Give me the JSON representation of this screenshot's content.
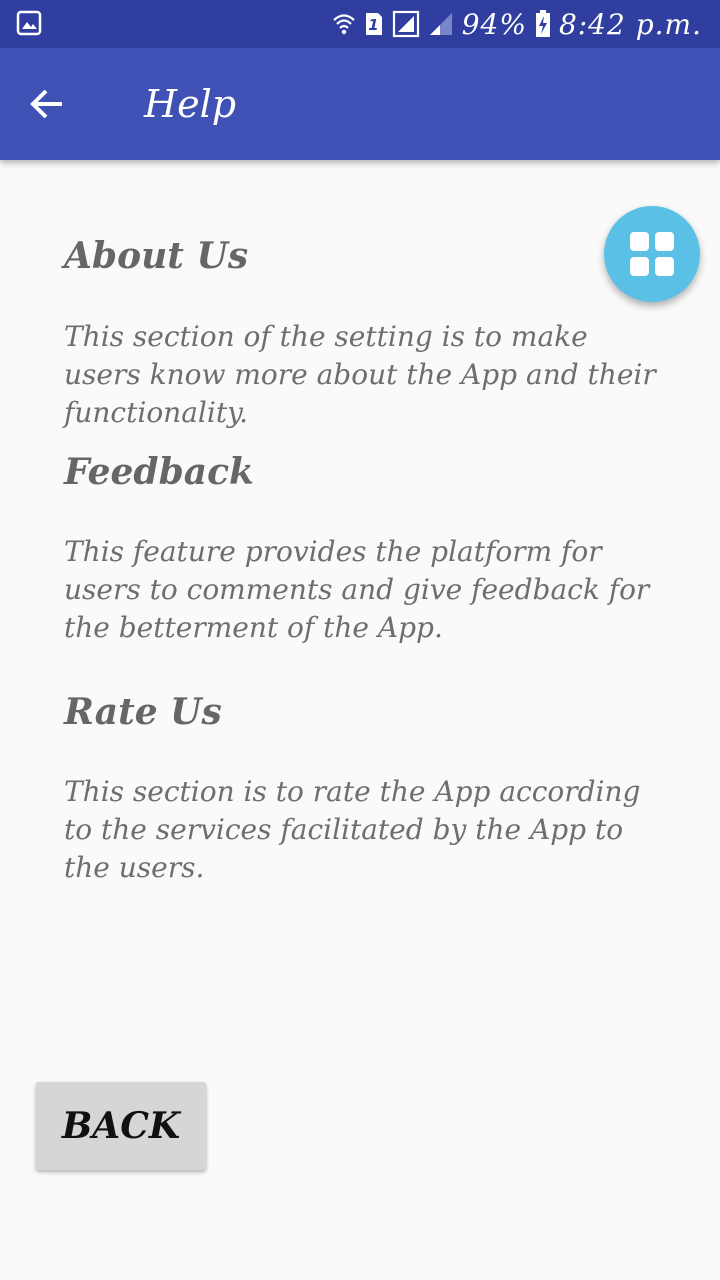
{
  "status_bar": {
    "battery": "94%",
    "time": "8:42 p.m.",
    "sim_slot": "1",
    "icons": [
      "gallery-notification-icon",
      "wifi-icon",
      "sim-icon",
      "no-signal-icon",
      "signal-icon",
      "battery-charging-icon"
    ]
  },
  "app_bar": {
    "title": "Help",
    "back_icon": "arrow-back-icon",
    "color": "#3f51b5"
  },
  "fab": {
    "icon": "grid-icon",
    "color": "#5bc0e6"
  },
  "sections": [
    {
      "title": "About Us",
      "body": "This section of the setting is to make users know more about the App and their functionality."
    },
    {
      "title": "Feedback",
      "body": "This feature provides the platform for users to comments and give feedback for the betterment of the App."
    },
    {
      "title": "Rate Us",
      "body": "This section is to rate the App according to the services facilitated by the App to the users."
    }
  ],
  "back_button": {
    "label": "BACK"
  }
}
